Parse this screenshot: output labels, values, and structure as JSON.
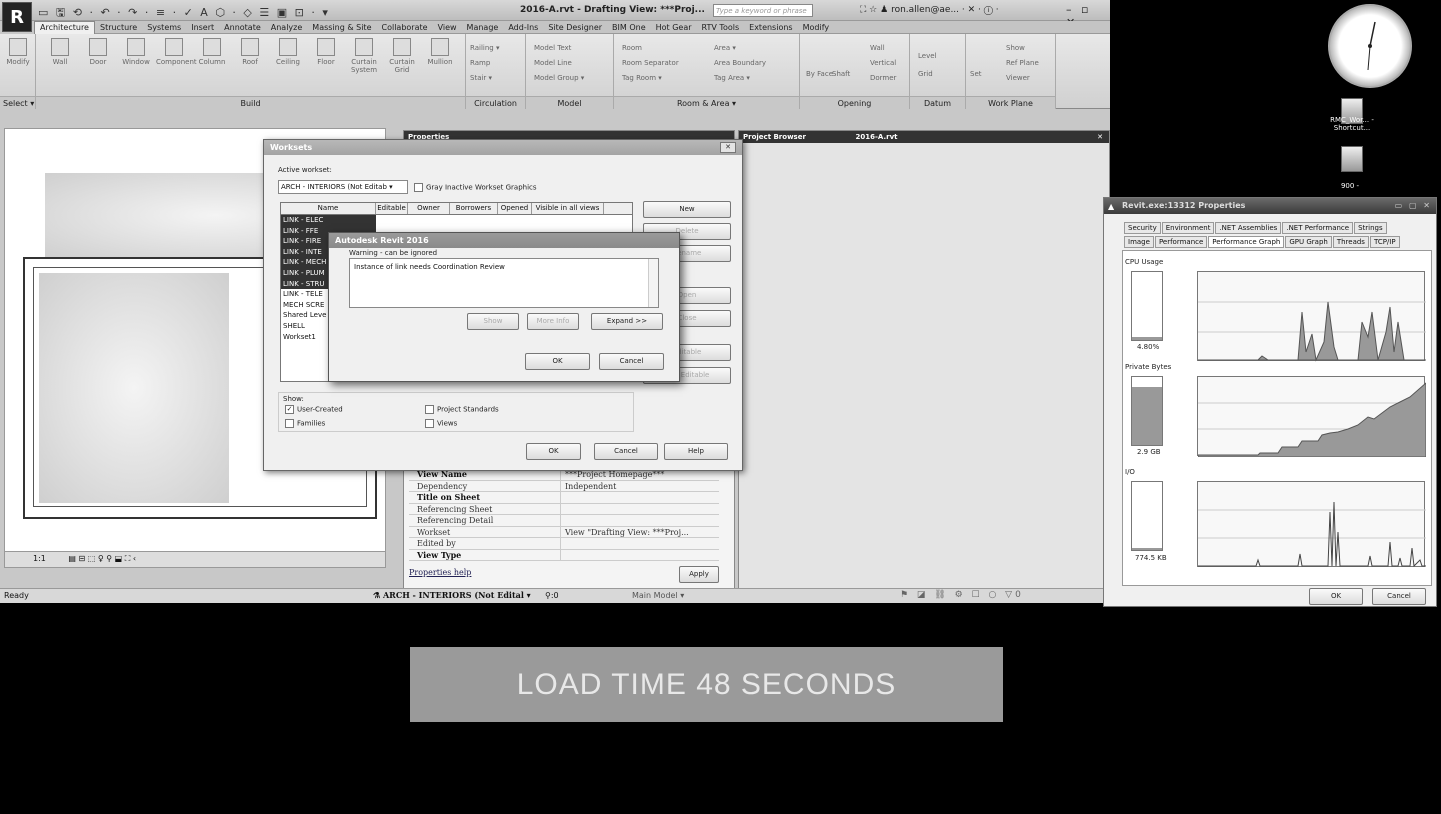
{
  "revit": {
    "logo": "R",
    "title": "2016-A.rvt - Drafting View: ***Proj...",
    "search_placeholder": "Type a keyword or phrase",
    "user": "ron.allen@ae...",
    "tabs": [
      "Architecture",
      "Structure",
      "Systems",
      "Insert",
      "Annotate",
      "Analyze",
      "Massing & Site",
      "Collaborate",
      "View",
      "Manage",
      "Add-Ins",
      "Site Designer",
      "BIM One",
      "Hot Gear",
      "RTV Tools",
      "Extensions",
      "Modify"
    ],
    "active_tab": "Architecture",
    "ribbon": {
      "select_label": "Select ▾",
      "modify": "Modify",
      "build_items": [
        "Wall",
        "Door",
        "Window",
        "Component",
        "Column",
        "Roof",
        "Ceiling",
        "Floor",
        "Curtain System",
        "Curtain Grid",
        "Mullion"
      ],
      "groups": [
        "Build",
        "Circulation",
        "Model",
        "Room & Area ▾",
        "Opening",
        "Datum",
        "Work Plane"
      ],
      "circulation_items": [
        "Railing ▾",
        "Ramp",
        "Stair ▾"
      ],
      "model_items": [
        "Model Text",
        "Model Line",
        "Model Group ▾"
      ],
      "room_items": [
        "Room",
        "Room Separator",
        "Tag Room ▾",
        "Area ▾",
        "Area Boundary",
        "Tag Area ▾"
      ],
      "opening_items": [
        "By Face",
        "Shaft",
        "Wall",
        "Vertical",
        "Dormer"
      ],
      "datum_items": [
        "Level",
        "Grid"
      ],
      "workplane_items": [
        "Set",
        "Show",
        "Ref Plane",
        "Viewer"
      ]
    },
    "panels": {
      "properties": "Properties",
      "project_browser": "Project Browser",
      "browser_file": "2016-A.rvt"
    },
    "properties_rows": [
      {
        "k": "View Name",
        "v": "***Project Homepage***",
        "bold": true
      },
      {
        "k": "Dependency",
        "v": "Independent",
        "bold": false
      },
      {
        "k": "Title on Sheet",
        "v": "",
        "bold": true
      },
      {
        "k": "Referencing Sheet",
        "v": "",
        "bold": false
      },
      {
        "k": "Referencing Detail",
        "v": "",
        "bold": false
      },
      {
        "k": "Workset",
        "v": "View \"Drafting View: ***Proj...",
        "bold": false
      },
      {
        "k": "Edited by",
        "v": "",
        "bold": false
      },
      {
        "k": "View Type",
        "v": "",
        "bold": true
      }
    ],
    "properties_help": "Properties help",
    "apply": "Apply",
    "view_scale": "1:1",
    "status_ready": "Ready",
    "status_workset": "ARCH - INTERIORS (Not Edital",
    "status_model": "Main Model",
    "status_zero": ":0"
  },
  "worksets_dialog": {
    "title": "Worksets",
    "active_workset_label": "Active workset:",
    "active_workset_value": "ARCH - INTERIORS (Not Editab",
    "gray_inactive": "Gray Inactive Workset Graphics",
    "columns": [
      "Name",
      "Editable",
      "Owner",
      "Borrowers",
      "Opened",
      "Visible in all views"
    ],
    "rows": [
      {
        "name": "LINK - ELEC",
        "sel": true
      },
      {
        "name": "LINK - FFE",
        "sel": true
      },
      {
        "name": "LINK - FIRE",
        "sel": true
      },
      {
        "name": "LINK - INTE",
        "sel": true
      },
      {
        "name": "LINK - MECH",
        "sel": true
      },
      {
        "name": "LINK - PLUM",
        "sel": true
      },
      {
        "name": "LINK - STRU",
        "sel": true
      },
      {
        "name": "LINK - TELE",
        "sel": false
      },
      {
        "name": "MECH SCRE",
        "sel": false
      },
      {
        "name": "Shared Leve",
        "sel": false
      },
      {
        "name": "SHELL",
        "sel": false
      },
      {
        "name": "Workset1",
        "sel": false
      }
    ],
    "buttons_right": [
      "New",
      "Delete",
      "Rename",
      "Open",
      "Close",
      "Editable",
      "Non Editable"
    ],
    "show_label": "Show:",
    "show_options": [
      {
        "label": "User-Created",
        "checked": true
      },
      {
        "label": "Project Standards",
        "checked": false
      },
      {
        "label": "Families",
        "checked": false
      },
      {
        "label": "Views",
        "checked": false
      }
    ],
    "ok": "OK",
    "cancel": "Cancel",
    "help": "Help"
  },
  "warning_dialog": {
    "title": "Autodesk Revit 2016",
    "subtitle": "Warning - can be ignored",
    "message": "Instance of link needs Coordination Review",
    "show": "Show",
    "more_info": "More Info",
    "expand": "Expand >>",
    "ok": "OK",
    "cancel": "Cancel"
  },
  "desktop": {
    "icon1_label": "RMC_Wor... - Shortcut...",
    "icon2_label": "900 -"
  },
  "task_properties": {
    "title": "Revit.exe:13312 Properties",
    "tabs_row1": [
      "Security",
      "Environment",
      ".NET Assemblies",
      ".NET Performance",
      "Strings"
    ],
    "tabs_row2": [
      "Image",
      "Performance",
      "Performance Graph",
      "GPU Graph",
      "Threads",
      "TCP/IP"
    ],
    "active_tab": "Performance Graph",
    "cpu_label": "CPU Usage",
    "cpu_value": "4.80%",
    "cpu_fraction": 0.048,
    "private_label": "Private Bytes",
    "private_value": "2.9 GB",
    "private_fraction": 0.85,
    "io_label": "I/O",
    "io_value": "774.5 KB",
    "io_fraction": 0.03,
    "ok": "OK",
    "cancel": "Cancel"
  },
  "banner": {
    "text": "LOAD TIME 48 SECONDS"
  }
}
